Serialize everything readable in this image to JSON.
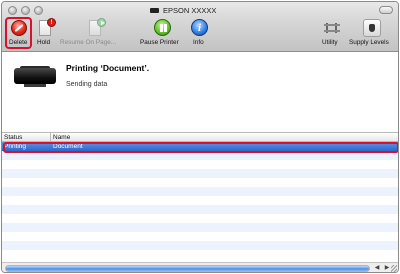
{
  "window": {
    "title": "EPSON XXXXX"
  },
  "toolbar": {
    "delete_label": "Delete",
    "hold_label": "Hold",
    "hold_badge": "!",
    "resume_label": "Resume On Page...",
    "pause_label": "Pause Printer",
    "info_label": "Info",
    "info_glyph": "i",
    "utility_label": "Utility",
    "supply_label": "Supply Levels"
  },
  "job": {
    "title": "Printing ‘Document’.",
    "status": "Sending data"
  },
  "table": {
    "columns": [
      "Status",
      "Name"
    ],
    "rows": [
      {
        "status": "Printing",
        "name": "Document",
        "selected": true
      }
    ],
    "empty_rows": 12
  },
  "scrollbar": {
    "left_arrow": "◀",
    "right_arrow": "▶"
  },
  "colors": {
    "highlight_outline": "#d6122e",
    "selection": "#3b72d4",
    "stripe": "#edf3fe"
  }
}
